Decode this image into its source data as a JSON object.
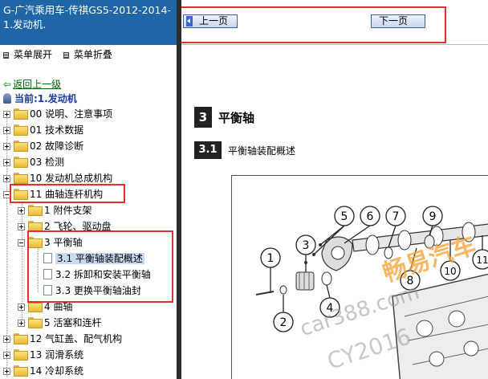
{
  "window_title": "G-广汽乘用车-传祺GS5-2012-2014- 1.发动机.",
  "menu": {
    "expand_label": "菜单展开",
    "collapse_label": "菜单折叠"
  },
  "back_link": "返回上一级",
  "current_label": "当前:1.发动机",
  "tree": [
    {
      "label": "00 说明、注意事项"
    },
    {
      "label": "01 技术数据"
    },
    {
      "label": "02 故障诊断"
    },
    {
      "label": "03 检测"
    },
    {
      "label": "10 发动机总成机构"
    },
    {
      "label": "11 曲轴连杆机构"
    },
    {
      "label": "1 附件支架"
    },
    {
      "label": "2 飞轮、驱动盘"
    },
    {
      "label": "3 平衡轴"
    },
    {
      "label": "3.1 平衡轴装配概述"
    },
    {
      "label": "3.2 拆卸和安装平衡轴"
    },
    {
      "label": "3.3 更换平衡轴油封"
    },
    {
      "label": "4 曲轴"
    },
    {
      "label": "5 活塞和连杆"
    },
    {
      "label": "12 气缸盖、配气机构"
    },
    {
      "label": "13 润滑系统"
    },
    {
      "label": "14 冷却系统"
    }
  ],
  "nav": {
    "prev_label": "上一页",
    "next_label": "下一页"
  },
  "doc": {
    "section_num": "3",
    "section_title": "平衡轴",
    "subsection_num": "3.1",
    "subsection_title": "平衡轴装配概述",
    "callouts": [
      "1",
      "2",
      "3",
      "4",
      "5",
      "6",
      "7",
      "8",
      "9",
      "10",
      "11"
    ]
  },
  "watermarks": {
    "brand": "畅易汽车",
    "site": "car388.com",
    "id": "CY2016"
  },
  "colors": {
    "title_bar": "#1e66a6",
    "highlight_box": "#e03030",
    "selected_bg": "#c9d9ef",
    "link_green": "#006600"
  }
}
